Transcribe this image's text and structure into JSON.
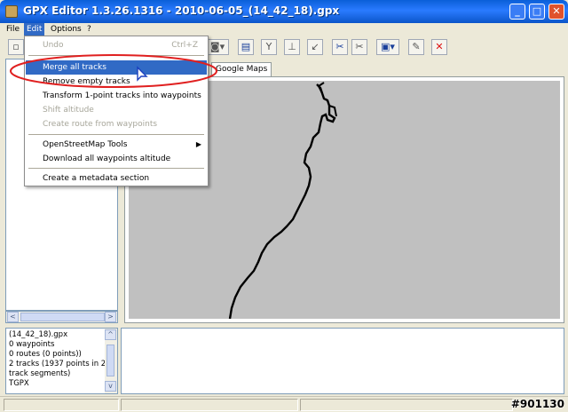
{
  "window": {
    "title": "GPX Editor 1.3.26.1316 - 2010-06-05_(14_42_18).gpx",
    "minimize": "_",
    "maximize": "□",
    "close": "✕"
  },
  "menubar": {
    "items": [
      {
        "label": "File"
      },
      {
        "label": "Edit"
      },
      {
        "label": "Options"
      },
      {
        "label": "?"
      }
    ]
  },
  "edit_menu": {
    "undo": {
      "label": "Undo",
      "shortcut": "Ctrl+Z"
    },
    "items": [
      {
        "label": "Merge all tracks"
      },
      {
        "label": "Remove empty tracks"
      },
      {
        "label": "Transform 1-point tracks into waypoints"
      },
      {
        "label": "Shift altitude"
      },
      {
        "label": "Create route from waypoints"
      },
      {
        "label": "OpenStreetMap Tools"
      },
      {
        "label": "Download all waypoints altitude"
      },
      {
        "label": "Create a metadata section"
      }
    ]
  },
  "tabs": {
    "google_maps": "Google Maps"
  },
  "info_panel": {
    "lines": [
      "(14_42_18).gpx",
      "0 waypoints",
      "0 routes (0 points))",
      "2 tracks (1937 points in 2",
      "track segments)",
      "TGPX"
    ]
  },
  "scroll": {
    "left": "<",
    "right": ">",
    "up": "^",
    "down": "v"
  },
  "watermark": "#901130",
  "colors": {
    "title_bar": "#0a5fd8",
    "menu_highlight": "#316ac5",
    "map_background": "#c0c0c0",
    "annotation_ellipse": "#e02020",
    "track_line": "#000000"
  }
}
